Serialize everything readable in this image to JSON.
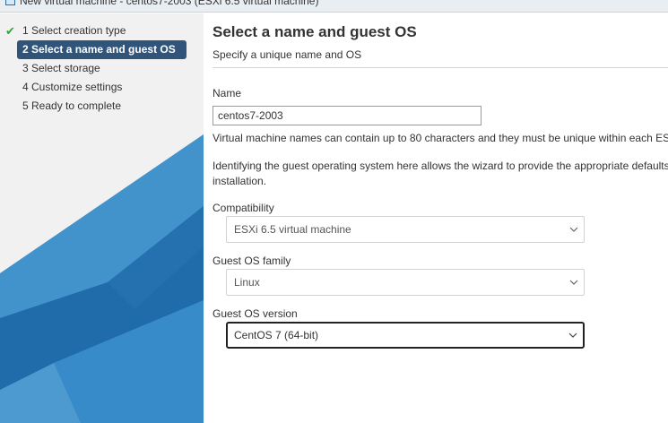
{
  "window": {
    "title": "New virtual machine - centos7-2003 (ESXi 6.5 virtual machine)"
  },
  "sidebar": {
    "steps": [
      {
        "label": "1  Select creation type",
        "completed": true
      },
      {
        "label": "2  Select a name and guest OS",
        "active": true
      },
      {
        "label": "3  Select storage"
      },
      {
        "label": "4  Customize settings"
      },
      {
        "label": "5  Ready to complete"
      }
    ],
    "check_icon": "check-icon",
    "colors": {
      "active_bg": "#31557a",
      "check": "#3aa13a",
      "accent_blue": "#2a7ab8"
    }
  },
  "main": {
    "title": "Select a name and guest OS",
    "subtitle": "Specify a unique name and OS",
    "name_label": "Name",
    "name_value": "centos7-2003",
    "name_help": "Virtual machine names can contain up to 80 characters and they must be unique within each ES",
    "os_help_line1": "Identifying the guest operating system here allows the wizard to provide the appropriate defaults",
    "os_help_line2": "installation.",
    "compatibility_label": "Compatibility",
    "compatibility_value": "ESXi 6.5 virtual machine",
    "os_family_label": "Guest OS family",
    "os_family_value": "Linux",
    "os_version_label": "Guest OS version",
    "os_version_value": "CentOS 7 (64-bit)"
  }
}
